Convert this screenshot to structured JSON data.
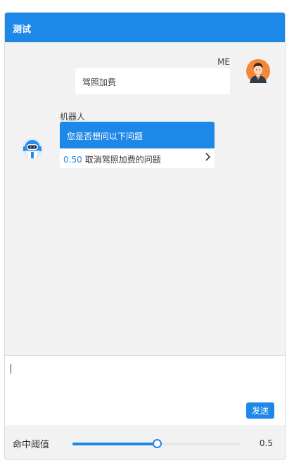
{
  "header": {
    "title": "测试"
  },
  "chat": {
    "user_message": {
      "sender": "ME",
      "text": "驾照加费"
    },
    "bot_message": {
      "sender": "机器人",
      "prompt": "您是否想问以下问题",
      "suggestions": [
        {
          "score": "0.50",
          "text": "取消驾照加费的问题"
        }
      ]
    }
  },
  "input": {
    "value": "",
    "send_label": "发送"
  },
  "threshold": {
    "label": "命中阈值",
    "value": 0.5,
    "value_text": "0.5"
  },
  "colors": {
    "accent": "#1e88e8",
    "background": "#f2f2f2"
  },
  "icons": {
    "user_avatar": "user-avatar-icon",
    "bot_avatar": "robot-avatar-icon",
    "suggestion_arrow": "chevron-right-icon"
  }
}
